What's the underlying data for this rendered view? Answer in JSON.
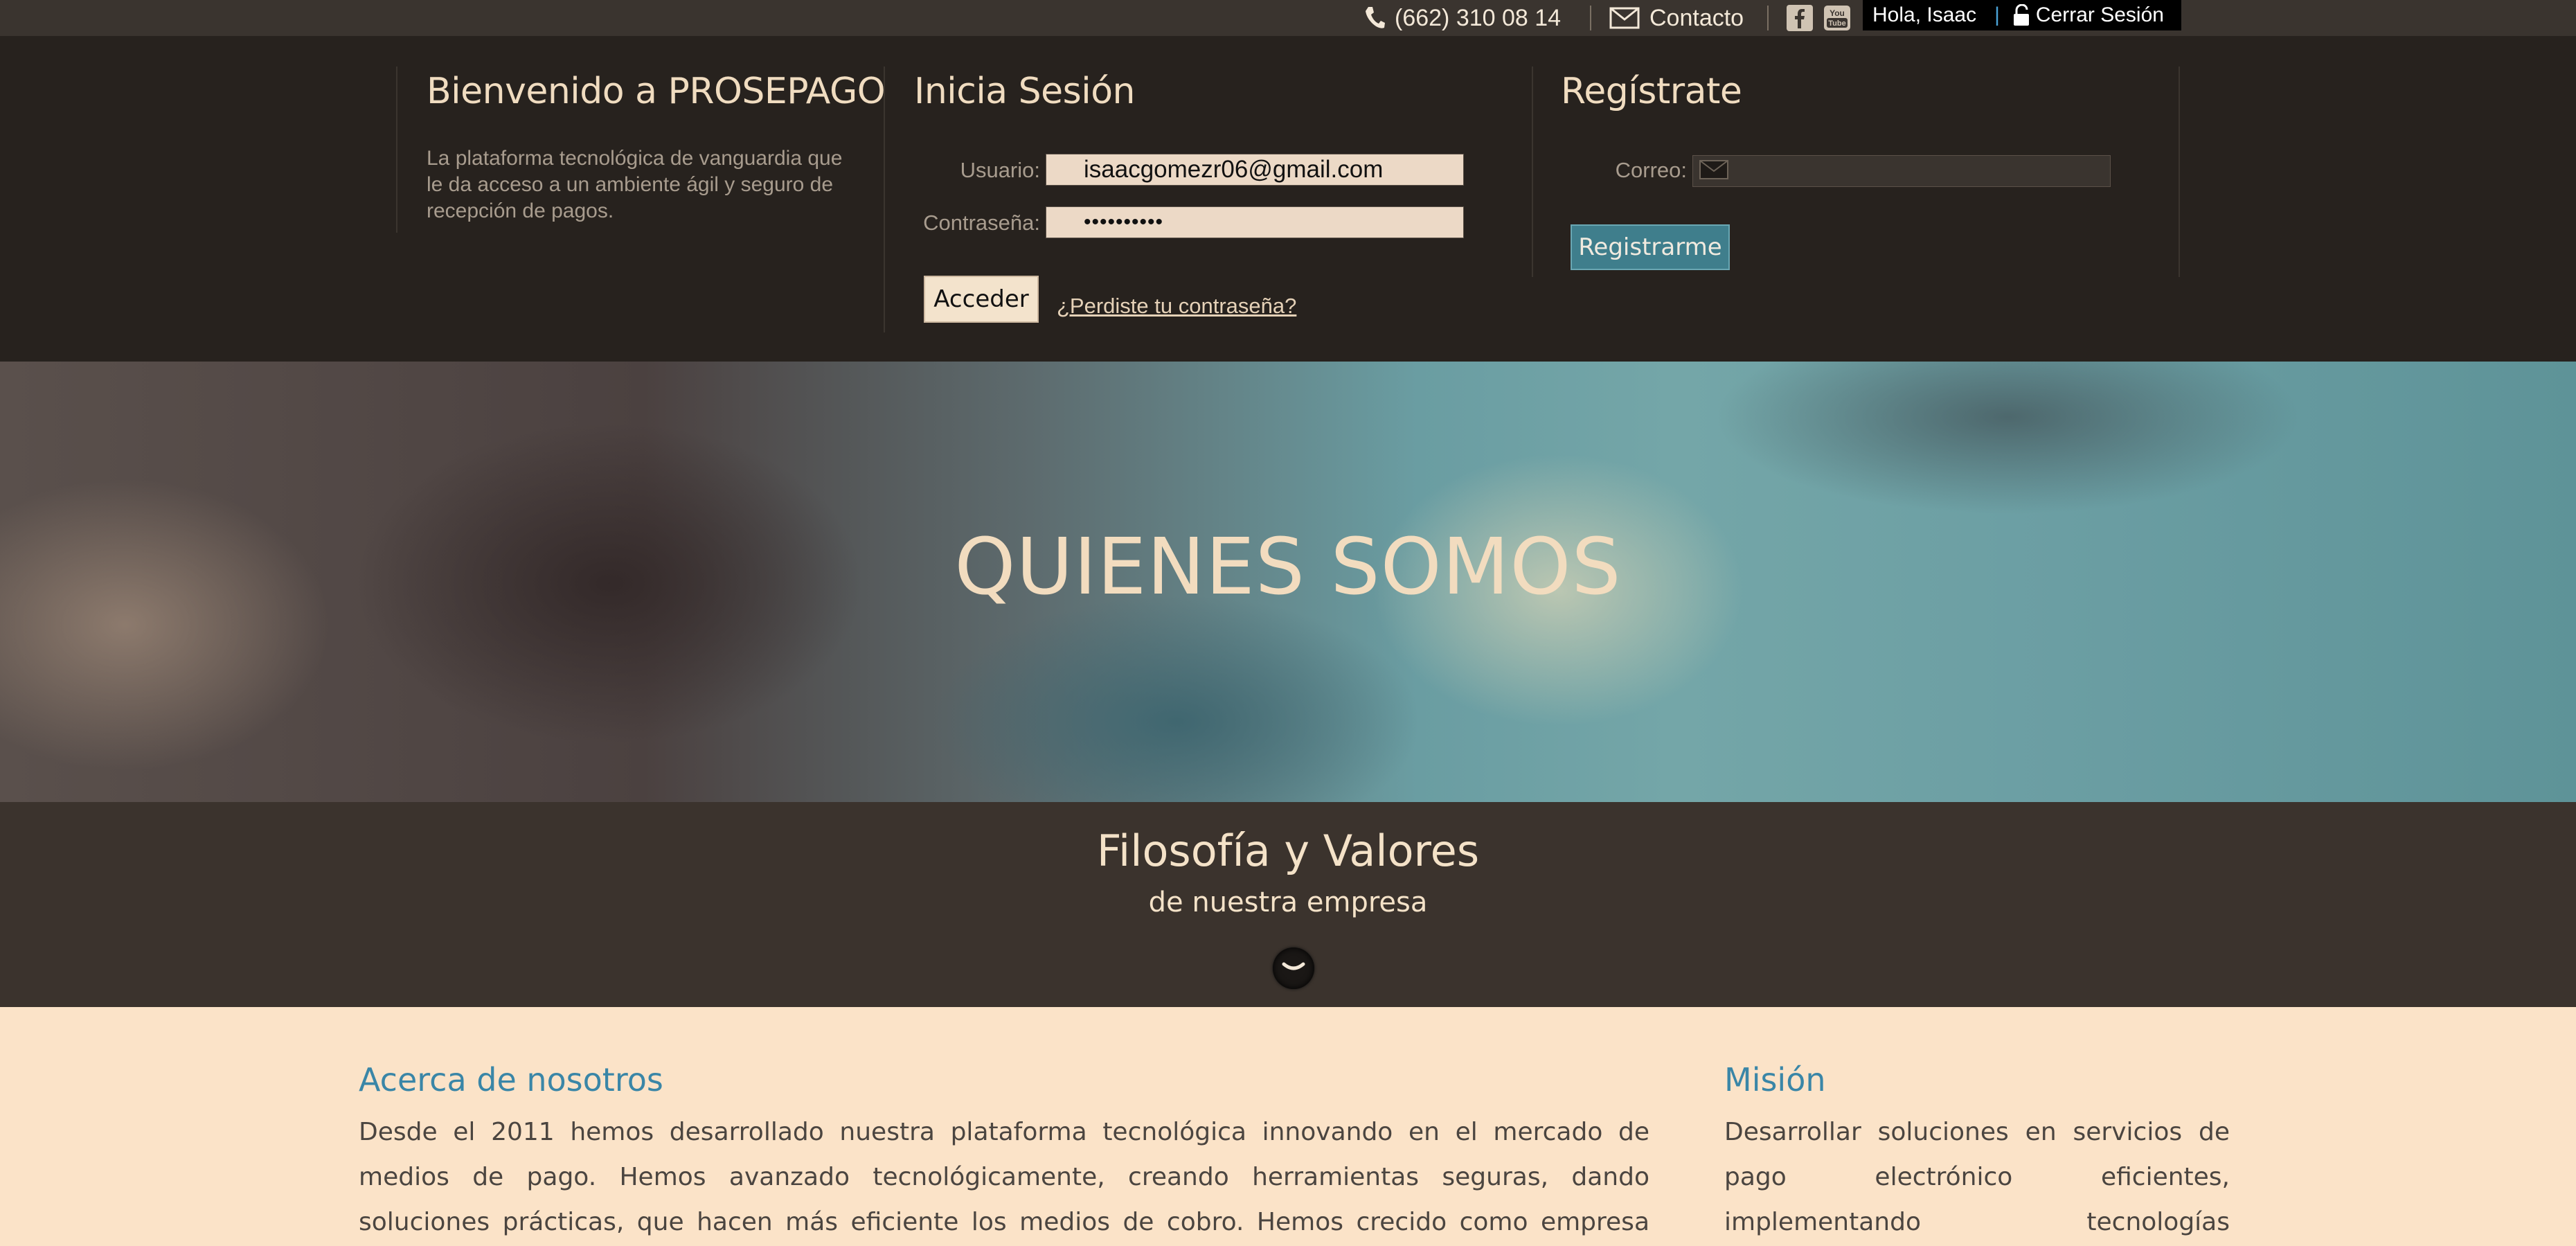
{
  "topbar": {
    "phone": "(662) 310 08 14",
    "contact_label": "Contacto",
    "greeting": "Hola, Isaac",
    "logout_label": "Cerrar Sesión",
    "icons": [
      "phone-icon",
      "mail-icon",
      "facebook-icon",
      "youtube-icon",
      "unlock-icon"
    ]
  },
  "welcome": {
    "title": "Bienvenido a PROSEPAGO",
    "description": "La plataforma tecnológica de vanguardia que le da acceso a un ambiente ágil y seguro de recepción de pagos."
  },
  "login": {
    "title": "Inicia Sesión",
    "user_label": "Usuario:",
    "user_value": "isaacgomezr06@gmail.com",
    "password_label": "Contraseña:",
    "password_value": "••••••••••",
    "submit_label": "Acceder",
    "forgot_label": "¿Perdiste tu contraseña?"
  },
  "register": {
    "title": "Regístrate",
    "email_label": "Correo:",
    "email_value": "",
    "submit_label": "Registrarme"
  },
  "hero": {
    "title": "QUIENES SOMOS"
  },
  "philosophy": {
    "title": "Filosofía y Valores",
    "subtitle": "de nuestra empresa"
  },
  "about": {
    "title": "Acerca de nosotros",
    "text": "Desde el 2011 hemos desarrollado nuestra plataforma tecnológica innovando en el mercado de medios de pago. Hemos avanzado tecnológicamente, creando herramientas seguras, dando soluciones prácticas, que hacen más eficiente los medios de cobro. Hemos crecido como empresa enfrentando las necesidades en el campo de batalla"
  },
  "mission": {
    "title": "Misión",
    "text": "Desarrollar soluciones en servicios de pago electrónico eficientes, implementando tecnologías innovadoras y un servicio de"
  },
  "colors": {
    "accent": "#3a86a7",
    "header_bg": "#27221e",
    "band_bg": "#3b332d",
    "content_bg": "#fbe3c8",
    "register_button": "#3f7e8c"
  }
}
